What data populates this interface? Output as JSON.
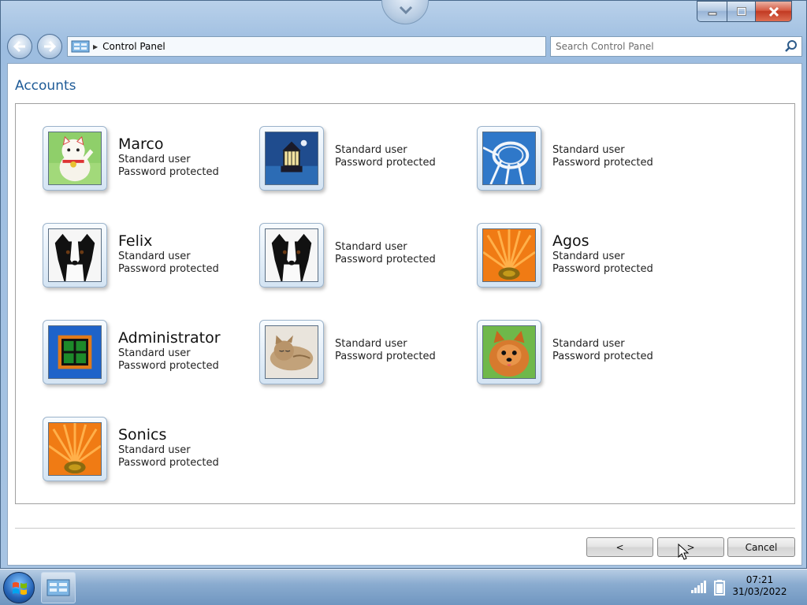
{
  "window": {
    "breadcrumb": "Control Panel",
    "search_placeholder": "Search Control Panel"
  },
  "page": {
    "title": "Accounts"
  },
  "accounts": [
    {
      "name": "Marco",
      "type": "Standard user",
      "status": "Password protected",
      "picture": "lucky-cat"
    },
    {
      "name": "",
      "type": "Standard user",
      "status": "Password protected",
      "picture": "lighthouse"
    },
    {
      "name": "",
      "type": "Standard user",
      "status": "Password protected",
      "picture": "roller-coaster"
    },
    {
      "name": "Felix",
      "type": "Standard user",
      "status": "Password protected",
      "picture": "dog"
    },
    {
      "name": "",
      "type": "Standard user",
      "status": "Password protected",
      "picture": "dog"
    },
    {
      "name": "Agos",
      "type": "Standard user",
      "status": "Password protected",
      "picture": "orange-flower"
    },
    {
      "name": "Administrator",
      "type": "Standard user",
      "status": "Password protected",
      "picture": "window"
    },
    {
      "name": "",
      "type": "Standard user",
      "status": "Password protected",
      "picture": "kitten"
    },
    {
      "name": "",
      "type": "Standard user",
      "status": "Password protected",
      "picture": "pomeranian"
    },
    {
      "name": "Sonics",
      "type": "Standard user",
      "status": "Password protected",
      "picture": "orange-flower"
    }
  ],
  "buttons": {
    "prev_label": "<",
    "next_label": ">",
    "cancel_label": "Cancel"
  },
  "taskbar": {
    "time": "07:21",
    "date": "31/03/2022"
  },
  "colors": {
    "title_blue": "#1e5b97",
    "close_red": "#c23a22"
  }
}
